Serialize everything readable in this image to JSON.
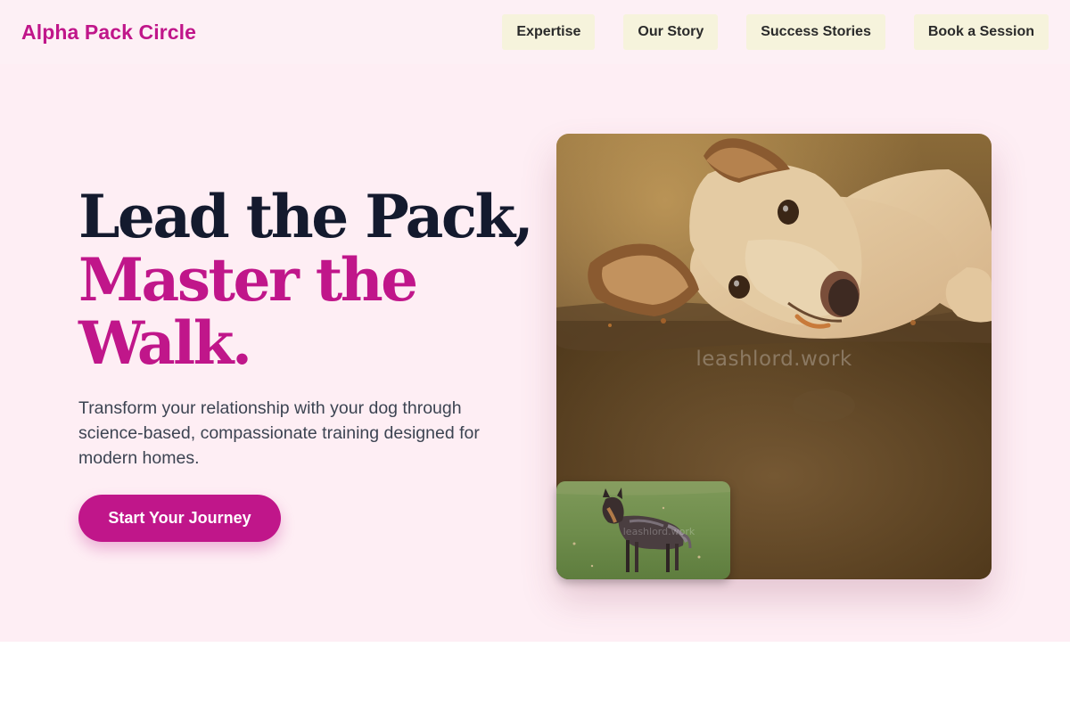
{
  "header": {
    "brand": "Alpha Pack Circle",
    "nav": [
      "Expertise",
      "Our Story",
      "Success Stories",
      "Book a Session"
    ]
  },
  "hero": {
    "headline_line1": "Lead the Pack,",
    "headline_accent_1": "Master the",
    "headline_accent_2": "Walk.",
    "subtitle": "Transform your relationship with your dog through science-based, compassionate training designed for modern homes.",
    "cta_label": "Start Your Journey",
    "main_image_watermark": "leashlord.work",
    "inset_image_watermark": "leashlord.work"
  },
  "colors": {
    "brand": "#c0168a",
    "hero_background": "#feeef4",
    "nav_background": "#fdf0f5",
    "nav_button": "#f6f3dc",
    "headline_dark": "#141a2e"
  }
}
